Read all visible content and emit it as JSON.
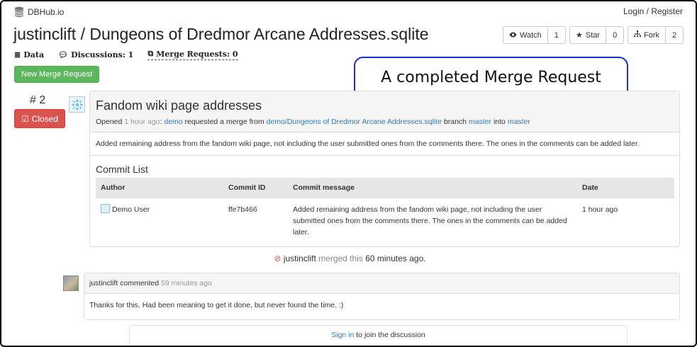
{
  "header": {
    "brand": "DBHub.io",
    "login": "Login / Register",
    "title": "justinclift / Dungeons of Dredmor Arcane Addresses.sqlite"
  },
  "actions": {
    "watch_label": "Watch",
    "watch_count": "1",
    "star_label": "Star",
    "star_count": "0",
    "fork_label": "Fork",
    "fork_count": "2"
  },
  "tabs": {
    "data": "Data",
    "discussions": "Discussions: 1",
    "merge_requests": "Merge Requests: 0"
  },
  "new_mr_button": "New Merge Request",
  "callout": "A completed Merge Request",
  "mr": {
    "number": "# 2",
    "status": "Closed",
    "title": "Fandom wiki page addresses",
    "opened": "Opened",
    "time_ago": "1 hour ago",
    "sep": ":",
    "author": "demo",
    "requested": "requested a merge from",
    "source": "demo/Dungeons of Dredmor Arcane Addresses.sqlite",
    "branch_word": "branch",
    "source_branch": "master",
    "into": "into",
    "dest_branch": "master",
    "description": "Added remaining address from the fandom wiki page, not including the user submitted ones from the comments there. The ones in the comments can be added later.",
    "commit_list_title": "Commit List",
    "columns": [
      "Author",
      "Commit ID",
      "Commit message",
      "Date"
    ],
    "commits": [
      {
        "author": "Demo User",
        "id": "ffe7b466",
        "message": "Added remaining address from the fandom wiki page, not including the user submitted ones from the comments there. The ones in the comments can be added later.",
        "date": "1 hour ago"
      }
    ]
  },
  "merged": {
    "user": "justinclift",
    "verb": "merged this",
    "when": "60 minutes ago."
  },
  "comment": {
    "user": "justinclift",
    "verb": "commented",
    "when": "59 minutes ago",
    "body": "Thanks for this. Had been meaning to get it done, but never found the time. :)"
  },
  "signin": {
    "link": "Sign in",
    "rest": "to join the discussion"
  },
  "colors": {
    "closed": "#d9534f",
    "new_mr": "#5cb85c",
    "link": "#337ab7",
    "callout_border": "#1c2fcf"
  }
}
